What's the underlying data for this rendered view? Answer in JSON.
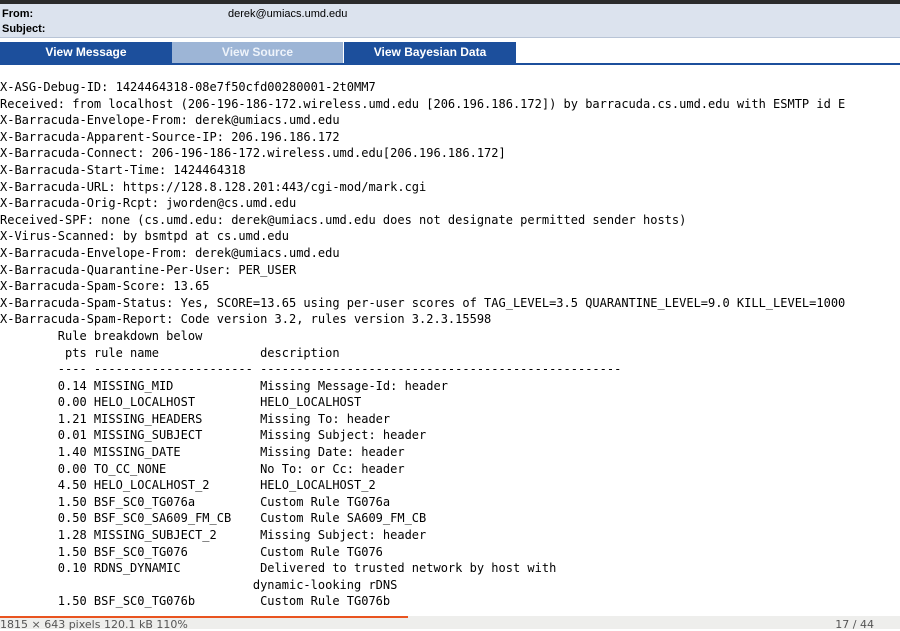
{
  "header": {
    "from_label": "From:",
    "from_value": "derek@umiacs.umd.edu",
    "subject_label": "Subject:",
    "subject_value": ""
  },
  "tabs": [
    {
      "label": "View Message",
      "active": false
    },
    {
      "label": "View Source",
      "active": true
    },
    {
      "label": "View Bayesian Data",
      "active": false
    }
  ],
  "source_lines": [
    "X-ASG-Debug-ID: 1424464318-08e7f50cfd00280001-2t0MM7",
    "Received: from localhost (206-196-186-172.wireless.umd.edu [206.196.186.172]) by barracuda.cs.umd.edu with ESMTP id E",
    "X-Barracuda-Envelope-From: derek@umiacs.umd.edu",
    "X-Barracuda-Apparent-Source-IP: 206.196.186.172",
    "X-Barracuda-Connect: 206-196-186-172.wireless.umd.edu[206.196.186.172]",
    "X-Barracuda-Start-Time: 1424464318",
    "X-Barracuda-URL: https://128.8.128.201:443/cgi-mod/mark.cgi",
    "X-Barracuda-Orig-Rcpt: jworden@cs.umd.edu",
    "Received-SPF: none (cs.umd.edu: derek@umiacs.umd.edu does not designate permitted sender hosts)",
    "X-Virus-Scanned: by bsmtpd at cs.umd.edu",
    "X-Barracuda-Envelope-From: derek@umiacs.umd.edu",
    "X-Barracuda-Quarantine-Per-User: PER_USER",
    "X-Barracuda-Spam-Score: 13.65",
    "X-Barracuda-Spam-Status: Yes, SCORE=13.65 using per-user scores of TAG_LEVEL=3.5 QUARANTINE_LEVEL=9.0 KILL_LEVEL=1000",
    "X-Barracuda-Spam-Report: Code version 3.2, rules version 3.2.3.15598",
    "        Rule breakdown below",
    "         pts rule name              description",
    "        ---- ---------------------- --------------------------------------------------",
    "        0.14 MISSING_MID            Missing Message-Id: header",
    "        0.00 HELO_LOCALHOST         HELO_LOCALHOST",
    "        1.21 MISSING_HEADERS        Missing To: header",
    "        0.01 MISSING_SUBJECT        Missing Subject: header",
    "        1.40 MISSING_DATE           Missing Date: header",
    "        0.00 TO_CC_NONE             No To: or Cc: header",
    "        4.50 HELO_LOCALHOST_2       HELO_LOCALHOST_2",
    "        1.50 BSF_SC0_TG076a         Custom Rule TG076a",
    "        0.50 BSF_SC0_SA609_FM_CB    Custom Rule SA609_FM_CB",
    "        1.28 MISSING_SUBJECT_2      Missing Subject: header",
    "        1.50 BSF_SC0_TG076          Custom Rule TG076",
    "        0.10 RDNS_DYNAMIC           Delivered to trusted network by host with",
    "                                   dynamic-looking rDNS",
    "        1.50 BSF_SC0_TG076b         Custom Rule TG076b"
  ],
  "statusbar": {
    "left": "1815 × 643 pixels  120.1 kB  110%",
    "right": "17 / 44"
  },
  "colors": {
    "tab_active": "#1c4f9c",
    "tab_inactive": "#9db5d6",
    "header_bg": "#dce3ee",
    "accent": "#e95420"
  }
}
